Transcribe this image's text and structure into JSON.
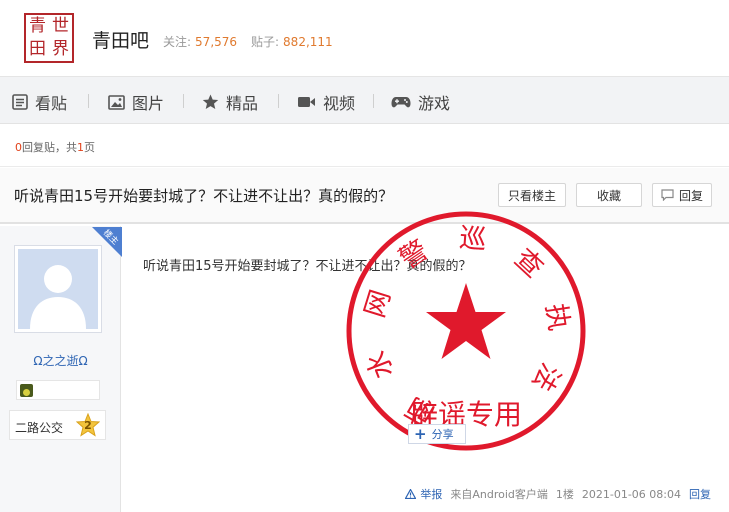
{
  "header": {
    "logo_chars": [
      "青",
      "世",
      "田",
      "界"
    ],
    "bar_name": "青田吧",
    "follow_label": "关注:",
    "follow_count": "57,576",
    "posts_label": "贴子:",
    "posts_count": "882,111"
  },
  "nav": {
    "items": [
      {
        "label": "看贴",
        "icon": "list-icon"
      },
      {
        "label": "图片",
        "icon": "image-icon"
      },
      {
        "label": "精品",
        "icon": "star-icon"
      },
      {
        "label": "视频",
        "icon": "video-icon"
      },
      {
        "label": "游戏",
        "icon": "gamepad-icon"
      }
    ]
  },
  "thread": {
    "reply_count": "0",
    "reply_suffix": "回复贴，共",
    "page_count": "1",
    "page_suffix": "页",
    "title": "听说青田15号开始要封城了？不让进不让出？真的假的？",
    "buttons": {
      "only_op": "只看楼主",
      "favorite": "收藏",
      "reply": "回复"
    }
  },
  "post": {
    "op_tag": "楼主",
    "author": {
      "name": "Ω之之逝Ω",
      "level_name": "二路公交",
      "level": "2"
    },
    "content": "听说青田15号开始要封城了？不让进不让出？真的假的？",
    "share_label": "分享",
    "footer": {
      "report": "举报",
      "client": "来自Android客户端",
      "floor": "1楼",
      "datetime": "2021-01-06 08:04",
      "reply": "回复"
    }
  },
  "stamp": {
    "arc_text": "丽水网警巡查执法",
    "bottom_text": "辟谣专用",
    "color": "#e0192c"
  }
}
